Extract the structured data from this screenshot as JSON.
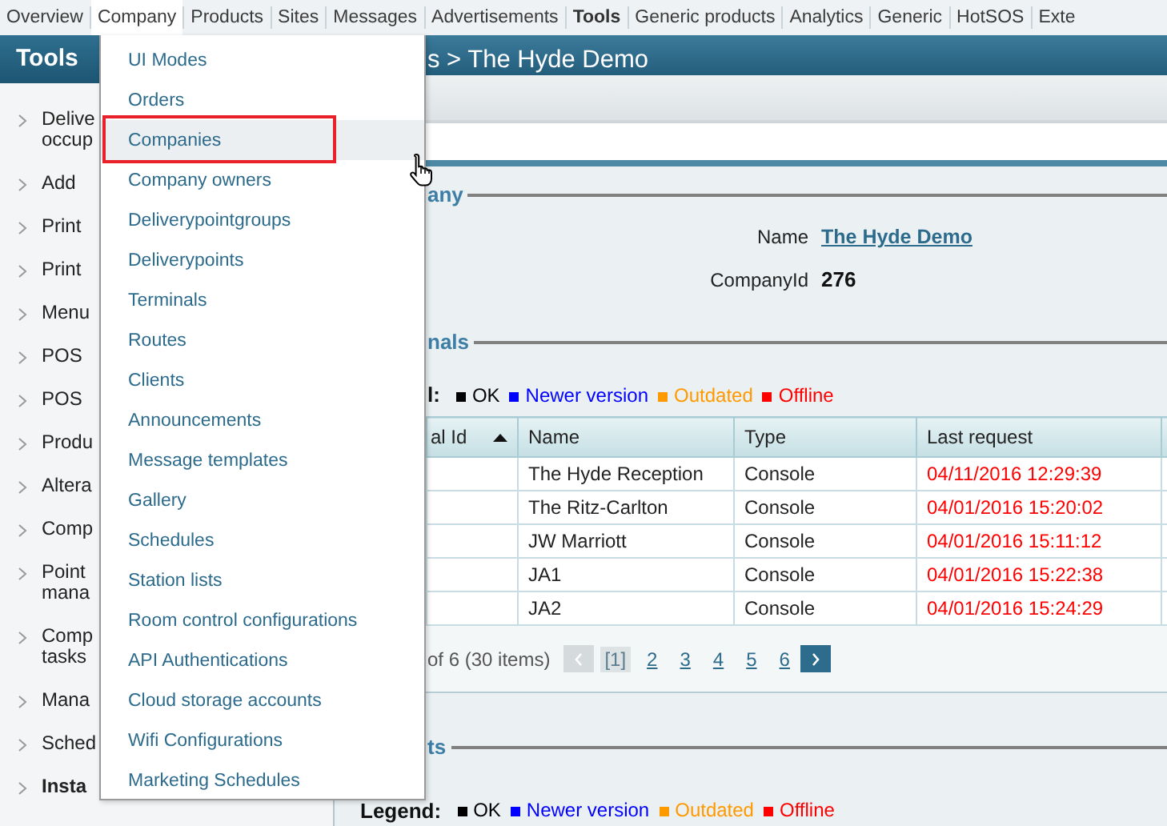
{
  "nav": [
    {
      "label": "Overview",
      "selected": false,
      "open": false
    },
    {
      "label": "Company",
      "selected": false,
      "open": true
    },
    {
      "label": "Products",
      "selected": false,
      "open": false
    },
    {
      "label": "Sites",
      "selected": false,
      "open": false
    },
    {
      "label": "Messages",
      "selected": false,
      "open": false
    },
    {
      "label": "Advertisements",
      "selected": false,
      "open": false
    },
    {
      "label": "Tools",
      "selected": true,
      "open": false
    },
    {
      "label": "Generic products",
      "selected": false,
      "open": false
    },
    {
      "label": "Analytics",
      "selected": false,
      "open": false
    },
    {
      "label": "Generic",
      "selected": false,
      "open": false
    },
    {
      "label": "HotSOS",
      "selected": false,
      "open": false
    },
    {
      "label": "Exte",
      "selected": false,
      "open": false
    }
  ],
  "sidebar": {
    "title": "Tools",
    "items": [
      {
        "label": "Delive\noccup",
        "bold": false
      },
      {
        "label": "Add",
        "bold": false
      },
      {
        "label": "Print",
        "bold": false
      },
      {
        "label": "Print",
        "bold": false
      },
      {
        "label": "Menu",
        "bold": false
      },
      {
        "label": "POS",
        "bold": false
      },
      {
        "label": "POS",
        "bold": false
      },
      {
        "label": "Produ",
        "bold": false
      },
      {
        "label": "Altera",
        "bold": false
      },
      {
        "label": "Comp",
        "bold": false
      },
      {
        "label": "Point\nmana",
        "bold": false
      },
      {
        "label": "Comp\ntasks",
        "bold": false
      },
      {
        "label": "Mana",
        "bold": false
      },
      {
        "label": "Sched",
        "bold": false
      },
      {
        "label": "Insta",
        "bold": true
      }
    ]
  },
  "menu": {
    "items": [
      {
        "label": "UI Modes",
        "selected": false
      },
      {
        "label": "Orders",
        "selected": false
      },
      {
        "label": "Companies",
        "selected": true
      },
      {
        "label": "Company owners",
        "selected": false
      },
      {
        "label": "Deliverypointgroups",
        "selected": false
      },
      {
        "label": "Deliverypoints",
        "selected": false
      },
      {
        "label": "Terminals",
        "selected": false
      },
      {
        "label": "Routes",
        "selected": false
      },
      {
        "label": "Clients",
        "selected": false
      },
      {
        "label": "Announcements",
        "selected": false
      },
      {
        "label": "Message templates",
        "selected": false
      },
      {
        "label": "Gallery",
        "selected": false
      },
      {
        "label": "Schedules",
        "selected": false
      },
      {
        "label": "Station lists",
        "selected": false
      },
      {
        "label": "Room control configurations",
        "selected": false
      },
      {
        "label": "API Authentications",
        "selected": false
      },
      {
        "label": "Cloud storage accounts",
        "selected": false
      },
      {
        "label": "Wifi Configurations",
        "selected": false
      },
      {
        "label": "Marketing Schedules",
        "selected": false
      }
    ]
  },
  "header": {
    "breadcrumb": "s > The Hyde Demo"
  },
  "company_section": {
    "legend": "any",
    "fields": [
      {
        "label": "Name",
        "value": "The Hyde Demo",
        "kind": "link"
      },
      {
        "label": "CompanyId",
        "value": "276",
        "kind": "bold"
      }
    ]
  },
  "terminals_section": {
    "legend": "nals",
    "legend_label": "l:",
    "legend_items": [
      {
        "label": "OK",
        "color": "#000000"
      },
      {
        "label": "Newer version",
        "color": "#0000ff"
      },
      {
        "label": "Outdated",
        "color": "#ff9900"
      },
      {
        "label": "Offline",
        "color": "#ff0000"
      }
    ],
    "table": {
      "columns": [
        {
          "label": "al Id",
          "sorted": true
        },
        {
          "label": "Name",
          "sorted": false
        },
        {
          "label": "Type",
          "sorted": false
        },
        {
          "label": "Last request",
          "sorted": false
        }
      ],
      "rows": [
        {
          "name": "The Hyde Reception",
          "type": "Console",
          "last_request": "04/11/2016 12:29:39",
          "color": "#ff0000"
        },
        {
          "name": "The Ritz-Carlton",
          "type": "Console",
          "last_request": "04/01/2016 15:20:02",
          "color": "#ff0000"
        },
        {
          "name": "JW Marriott",
          "type": "Console",
          "last_request": "04/01/2016 15:11:12",
          "color": "#ff0000"
        },
        {
          "name": "JA1",
          "type": "Console",
          "last_request": "04/01/2016 15:22:38",
          "color": "#ff0000"
        },
        {
          "name": "JA2",
          "type": "Console",
          "last_request": "04/01/2016 15:24:29",
          "color": "#ff0000"
        }
      ]
    },
    "pager": {
      "summary": "of 6 (30 items)",
      "prev_disabled": true,
      "next_disabled": false,
      "pages": [
        {
          "label": "[1]",
          "selected": true
        },
        {
          "label": "2",
          "selected": false
        },
        {
          "label": "3",
          "selected": false
        },
        {
          "label": "4",
          "selected": false
        },
        {
          "label": "5",
          "selected": false
        },
        {
          "label": "6",
          "selected": false
        }
      ]
    }
  },
  "clients_section": {
    "legend": "ts",
    "legend_label": "Legend:",
    "legend_items": [
      {
        "label": "OK",
        "color": "#000000"
      },
      {
        "label": "Newer version",
        "color": "#0000ff"
      },
      {
        "label": "Outdated",
        "color": "#ff9900"
      },
      {
        "label": "Offline",
        "color": "#ff0000"
      }
    ]
  }
}
